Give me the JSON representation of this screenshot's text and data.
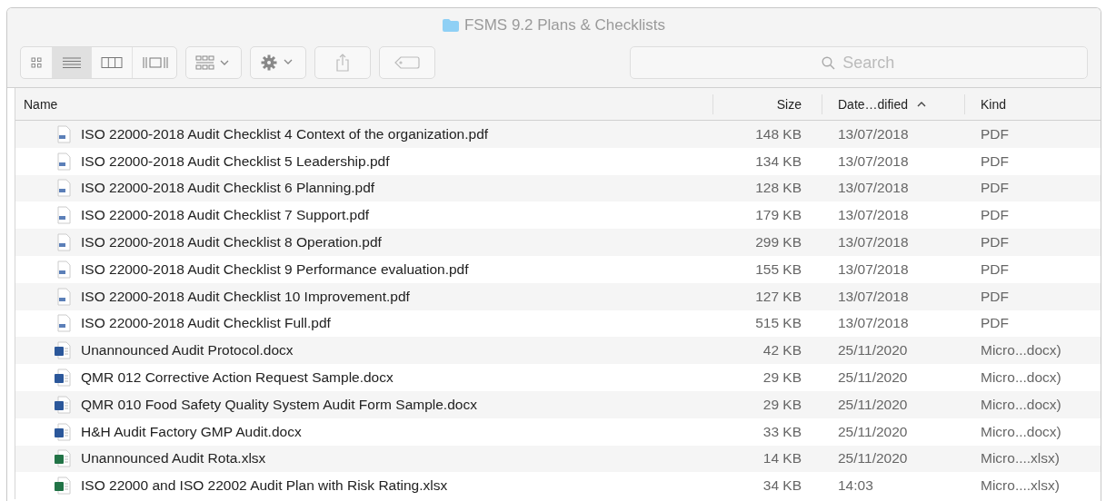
{
  "window": {
    "title": "FSMS 9.2 Plans & Checklists"
  },
  "toolbar": {
    "view_modes": [
      {
        "kind": "icons",
        "selected": false
      },
      {
        "kind": "list",
        "selected": true
      },
      {
        "kind": "columns",
        "selected": false
      },
      {
        "kind": "gallery",
        "selected": false
      }
    ]
  },
  "search": {
    "placeholder": "Search"
  },
  "table": {
    "columns": [
      {
        "label": "Name",
        "sorted": false
      },
      {
        "label": "Size",
        "sorted": false
      },
      {
        "label": "Date…dified",
        "sorted": true
      },
      {
        "label": "Kind",
        "sorted": false
      }
    ],
    "rows": [
      {
        "kind": "pdf",
        "name": "ISO 22000-2018 Audit Checklist 4 Context of the organization.pdf",
        "size": "148 KB",
        "date": "13/07/2018",
        "type": "PDF"
      },
      {
        "kind": "pdf",
        "name": "ISO 22000-2018 Audit Checklist 5 Leadership.pdf",
        "size": "134 KB",
        "date": "13/07/2018",
        "type": "PDF"
      },
      {
        "kind": "pdf",
        "name": "ISO 22000-2018 Audit Checklist 6 Planning.pdf",
        "size": "128 KB",
        "date": "13/07/2018",
        "type": "PDF"
      },
      {
        "kind": "pdf",
        "name": "ISO 22000-2018 Audit Checklist 7 Support.pdf",
        "size": "179 KB",
        "date": "13/07/2018",
        "type": "PDF"
      },
      {
        "kind": "pdf",
        "name": "ISO 22000-2018 Audit Checklist 8 Operation.pdf",
        "size": "299 KB",
        "date": "13/07/2018",
        "type": "PDF"
      },
      {
        "kind": "pdf",
        "name": "ISO 22000-2018 Audit Checklist 9 Performance evaluation.pdf",
        "size": "155 KB",
        "date": "13/07/2018",
        "type": "PDF"
      },
      {
        "kind": "pdf",
        "name": "ISO 22000-2018 Audit Checklist 10 Improvement.pdf",
        "size": "127 KB",
        "date": "13/07/2018",
        "type": "PDF"
      },
      {
        "kind": "pdf",
        "name": "ISO 22000-2018 Audit Checklist Full.pdf",
        "size": "515 KB",
        "date": "13/07/2018",
        "type": "PDF"
      },
      {
        "kind": "word",
        "name": "Unannounced Audit Protocol.docx",
        "size": "42 KB",
        "date": "25/11/2020",
        "type": "Micro...docx)"
      },
      {
        "kind": "word",
        "name": "QMR 012 Corrective Action Request Sample.docx",
        "size": "29 KB",
        "date": "25/11/2020",
        "type": "Micro...docx)"
      },
      {
        "kind": "word",
        "name": "QMR 010 Food Safety Quality System Audit Form Sample.docx",
        "size": "29 KB",
        "date": "25/11/2020",
        "type": "Micro...docx)"
      },
      {
        "kind": "word",
        "name": "H&H Audit Factory GMP Audit.docx",
        "size": "33 KB",
        "date": "25/11/2020",
        "type": "Micro...docx)"
      },
      {
        "kind": "excel",
        "name": "Unannounced Audit Rota.xlsx",
        "size": "14 KB",
        "date": "25/11/2020",
        "type": "Micro....xlsx)"
      },
      {
        "kind": "excel",
        "name": "ISO 22000 and ISO 22002 Audit Plan with Risk Rating.xlsx",
        "size": "34 KB",
        "date": "14:03",
        "type": "Micro....xlsx)"
      }
    ]
  }
}
